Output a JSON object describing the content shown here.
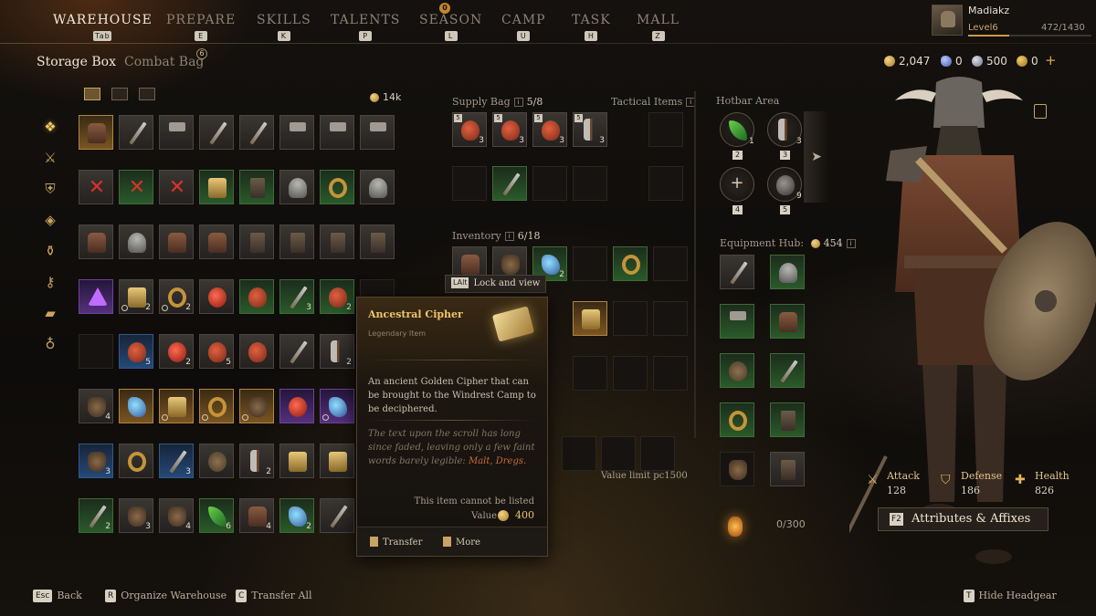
{
  "nav": {
    "tabs": [
      {
        "label": "WAREHOUSE",
        "key": "Tab"
      },
      {
        "label": "PREPARE",
        "key": "E"
      },
      {
        "label": "SKILLS",
        "key": "K"
      },
      {
        "label": "TALENTS",
        "key": "P"
      },
      {
        "label": "SEASON",
        "key": "L"
      },
      {
        "label": "CAMP",
        "key": "U"
      },
      {
        "label": "TASK",
        "key": "H"
      },
      {
        "label": "MALL",
        "key": "Z"
      }
    ],
    "season_badge": "0"
  },
  "player": {
    "name": "Madiakz",
    "level": "Level6",
    "xp": "472/1430",
    "xp_fraction": 0.33
  },
  "currency": {
    "gold": "2,047",
    "blue": "0",
    "silver": "500",
    "seal": "0",
    "add": "+"
  },
  "subtabs": {
    "storage": "Storage Box",
    "combat": "Combat Bag",
    "combat_badge": "6"
  },
  "warehouse": {
    "count": "14k",
    "categories": [
      "all-icon",
      "sword-icon",
      "armor-icon",
      "gem-icon",
      "potion-icon",
      "key-icon",
      "ingot-icon",
      "bag-icon"
    ],
    "slots": [
      {
        "r": "gold",
        "it": "armor"
      },
      {
        "r": "gray",
        "it": "sword"
      },
      {
        "r": "gray",
        "it": "hammer"
      },
      {
        "r": "gray",
        "it": "sword"
      },
      {
        "r": "gray",
        "it": "sword"
      },
      {
        "r": "gray",
        "it": "hammer"
      },
      {
        "r": "gray",
        "it": "hammer"
      },
      {
        "r": "gray",
        "it": "hammer"
      },
      {
        "r": "gray",
        "it": "red"
      },
      {
        "r": "green",
        "it": "red"
      },
      {
        "r": "gray",
        "it": "red"
      },
      {
        "r": "green",
        "it": "scroll"
      },
      {
        "r": "green",
        "it": "legs"
      },
      {
        "r": "gray",
        "it": "helm"
      },
      {
        "r": "green",
        "it": "ring"
      },
      {
        "r": "gray",
        "it": "helm"
      },
      {
        "r": "gray",
        "it": "armor"
      },
      {
        "r": "gray",
        "it": "helm"
      },
      {
        "r": "gray",
        "it": "armor"
      },
      {
        "r": "gray",
        "it": "armor"
      },
      {
        "r": "gray",
        "it": "legs"
      },
      {
        "r": "gray",
        "it": "legs"
      },
      {
        "r": "gray",
        "it": "legs"
      },
      {
        "r": "gray",
        "it": "legs"
      },
      {
        "r": "purple",
        "it": "tri"
      },
      {
        "r": "gray",
        "it": "scroll",
        "q": "2",
        "lock": true
      },
      {
        "r": "gray",
        "it": "ring",
        "q": "2",
        "lock": true
      },
      {
        "r": "gray",
        "it": "orb"
      },
      {
        "r": "green",
        "it": "potion"
      },
      {
        "r": "green",
        "it": "sword",
        "q": "3"
      },
      {
        "r": "green",
        "it": "potion",
        "q": "2"
      },
      {
        "r": "empty",
        "it": ""
      },
      {
        "r": "empty",
        "it": ""
      },
      {
        "r": "blue",
        "it": "potion",
        "q": "5"
      },
      {
        "r": "gray",
        "it": "orb",
        "q": "2"
      },
      {
        "r": "gray",
        "it": "potion",
        "q": "5"
      },
      {
        "r": "gray",
        "it": "potion"
      },
      {
        "r": "gray",
        "it": "sword"
      },
      {
        "r": "gray",
        "it": "axe",
        "q": "2"
      },
      {
        "r": "empty",
        "it": ""
      },
      {
        "r": "gray",
        "it": "bag",
        "q": "4"
      },
      {
        "r": "gold",
        "it": "gem"
      },
      {
        "r": "gold",
        "it": "scroll",
        "lock": true
      },
      {
        "r": "gold",
        "it": "ring",
        "lock": true
      },
      {
        "r": "gold",
        "it": "bag",
        "lock": true
      },
      {
        "r": "purple",
        "it": "orb"
      },
      {
        "r": "purple",
        "it": "gem",
        "lock": true
      },
      {
        "r": "empty",
        "it": ""
      },
      {
        "r": "blue",
        "it": "bag",
        "q": "3"
      },
      {
        "r": "gray",
        "it": "ring"
      },
      {
        "r": "blue",
        "it": "sword",
        "q": "3"
      },
      {
        "r": "gray",
        "it": "shield"
      },
      {
        "r": "gray",
        "it": "axe",
        "q": "2"
      },
      {
        "r": "gray",
        "it": "scroll"
      },
      {
        "r": "gray",
        "it": "scroll"
      },
      {
        "r": "empty",
        "it": ""
      },
      {
        "r": "green",
        "it": "sword",
        "q": "2"
      },
      {
        "r": "gray",
        "it": "bag",
        "q": "3"
      },
      {
        "r": "gray",
        "it": "bag",
        "q": "4"
      },
      {
        "r": "green",
        "it": "leaf",
        "q": "6"
      },
      {
        "r": "gray",
        "it": "armor",
        "q": "4"
      },
      {
        "r": "green",
        "it": "gem",
        "q": "2"
      },
      {
        "r": "gray",
        "it": "sword"
      },
      {
        "r": "empty",
        "it": ""
      }
    ]
  },
  "supply": {
    "title": "Supply Bag",
    "count": "5/8",
    "tactical": "Tactical Items"
  },
  "inventory": {
    "title": "Inventory",
    "count": "6/18",
    "value_limit": "Value limit pc1500",
    "capacity": "0/300"
  },
  "hotbar": {
    "title": "Hotbar Area",
    "keys": [
      "1",
      "2",
      "3",
      "4",
      "5"
    ],
    "qty": [
      "1",
      "3",
      "9"
    ]
  },
  "equipment": {
    "title": "Equipment Hub:",
    "value": "454"
  },
  "tooltip": {
    "lock_key": "LAlt",
    "lock_text": "Lock and view",
    "name": "Ancestral Cipher",
    "rarity": "Legendary Item",
    "desc": "An ancient Golden Cipher that can be brought to the Windrest Camp to be deciphered.",
    "lore": "The text upon the scroll has long since faded, leaving only a few faint words barely legible:",
    "lore_hl": "Malt, Dregs.",
    "nolist": "This item cannot be listed",
    "value_label": "Value",
    "value": "400",
    "transfer": "Transfer",
    "more": "More"
  },
  "stats": {
    "attack_label": "Attack",
    "attack": "128",
    "defense_label": "Defense",
    "defense": "186",
    "health_label": "Health",
    "health": "826"
  },
  "attr_button": {
    "key": "F2",
    "label": "Attributes & Affixes"
  },
  "bottom": {
    "back_key": "Esc",
    "back": "Back",
    "organize_key": "R",
    "organize": "Organize Warehouse",
    "transfer_key": "C",
    "transfer": "Transfer All",
    "headgear_key": "T",
    "headgear": "Hide Headgear"
  }
}
